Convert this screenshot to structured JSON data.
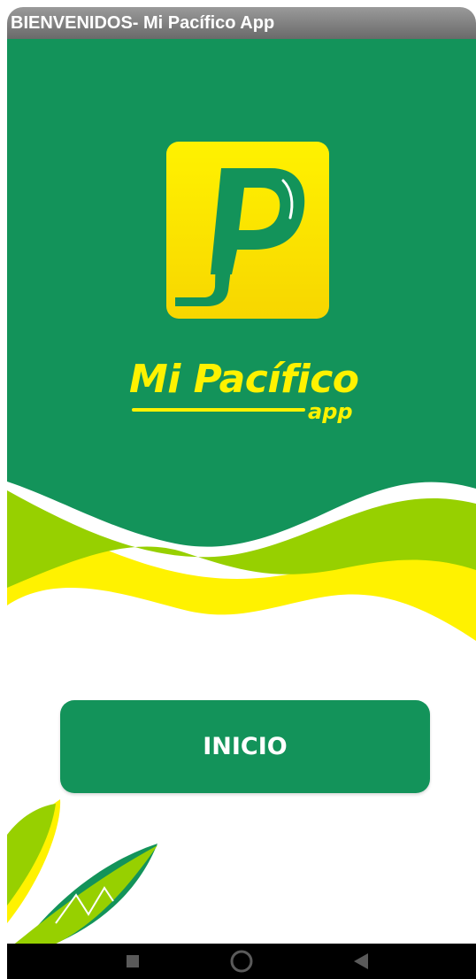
{
  "titlebar": {
    "title": "BIENVENIDOS- Mi Pacífico App"
  },
  "brand": {
    "name": "Mi Pacífico",
    "sub": "app"
  },
  "main": {
    "start_label": "INICIO"
  },
  "icons": {
    "logo": "mi-pacifico-p-logo",
    "decoration": "banana-leaves",
    "nav_recents": "square-recents-icon",
    "nav_home": "circle-home-icon",
    "nav_back": "triangle-back-icon"
  },
  "colors": {
    "brand_green": "#13935a",
    "brand_yellow": "#fff200",
    "lime": "#97d000",
    "titlebar": "#7c7c7c"
  }
}
